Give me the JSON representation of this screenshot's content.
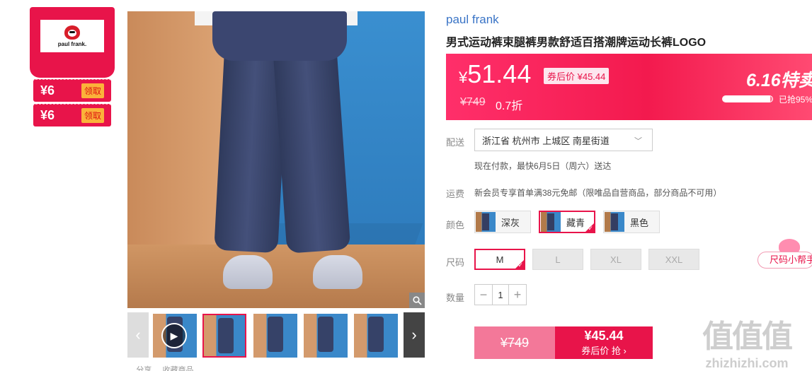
{
  "coupons": {
    "brand_name": "paul frank.",
    "items": [
      {
        "amount": "¥6",
        "action": "领取"
      },
      {
        "amount": "¥6",
        "action": "领取"
      }
    ]
  },
  "gallery": {
    "zoom_icon": "magnifier-icon",
    "prev_icon": "‹",
    "next_icon": "›",
    "play_icon": "▶",
    "bottom_text": "... 分享 ... 收藏商品"
  },
  "product": {
    "brand": "paul frank",
    "title": "男式运动裤束腿裤男款舒适百搭潮牌运动长裤LOGO"
  },
  "price": {
    "currency": "¥",
    "current": "51.44",
    "after_coupon": "券后价 ¥45.44",
    "original": "¥749",
    "discount": "0.7折",
    "event_title": "6.16特卖",
    "sold_percent": 95,
    "sold_text": "已抢95%"
  },
  "delivery": {
    "label": "配送",
    "address": "浙江省 杭州市 上城区 南星街道",
    "note": "现在付款，最快6月5日（周六）送达"
  },
  "shipping_fee": {
    "label": "运费",
    "text": "新会员专享首单满38元免邮（限唯品自营商品，部分商品不可用）"
  },
  "color": {
    "label": "颜色",
    "options": [
      "深灰",
      "藏青",
      "黑色"
    ],
    "selected": "藏青"
  },
  "size": {
    "label": "尺码",
    "options": [
      "M",
      "L",
      "XL",
      "XXL"
    ],
    "selected": "M",
    "helper": "尺码小帮手"
  },
  "quantity": {
    "label": "数量",
    "minus": "−",
    "value": "1",
    "plus": "+"
  },
  "buy": {
    "original_price": "¥749",
    "coupon_price": "¥45.44",
    "coupon_action": "券后价 抢 ›"
  },
  "watermark": {
    "logo": "值值值",
    "site": "zhizhizhi.com"
  }
}
